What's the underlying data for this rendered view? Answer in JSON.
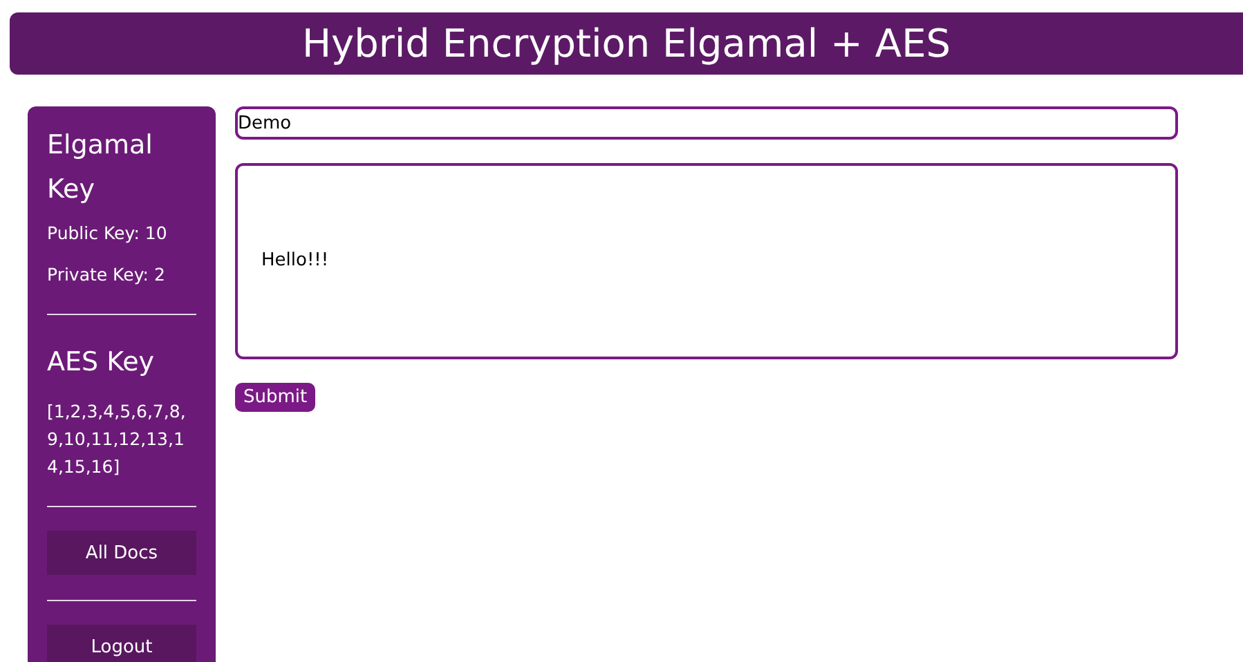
{
  "header": {
    "title": "Hybrid Encryption Elgamal + AES"
  },
  "sidebar": {
    "elgamal_heading": "Elgamal Key",
    "public_key": "Public Key: 10",
    "private_key": "Private Key: 2",
    "aes_heading": "AES Key",
    "aes_key": "[1,2,3,4,5,6,7,8,9,10,11,12,13,14,15,16]",
    "buttons": [
      "All Docs",
      "Logout"
    ]
  },
  "form": {
    "title_value": "Demo",
    "message_value": "Hello!!!",
    "submit": "Submit"
  }
}
